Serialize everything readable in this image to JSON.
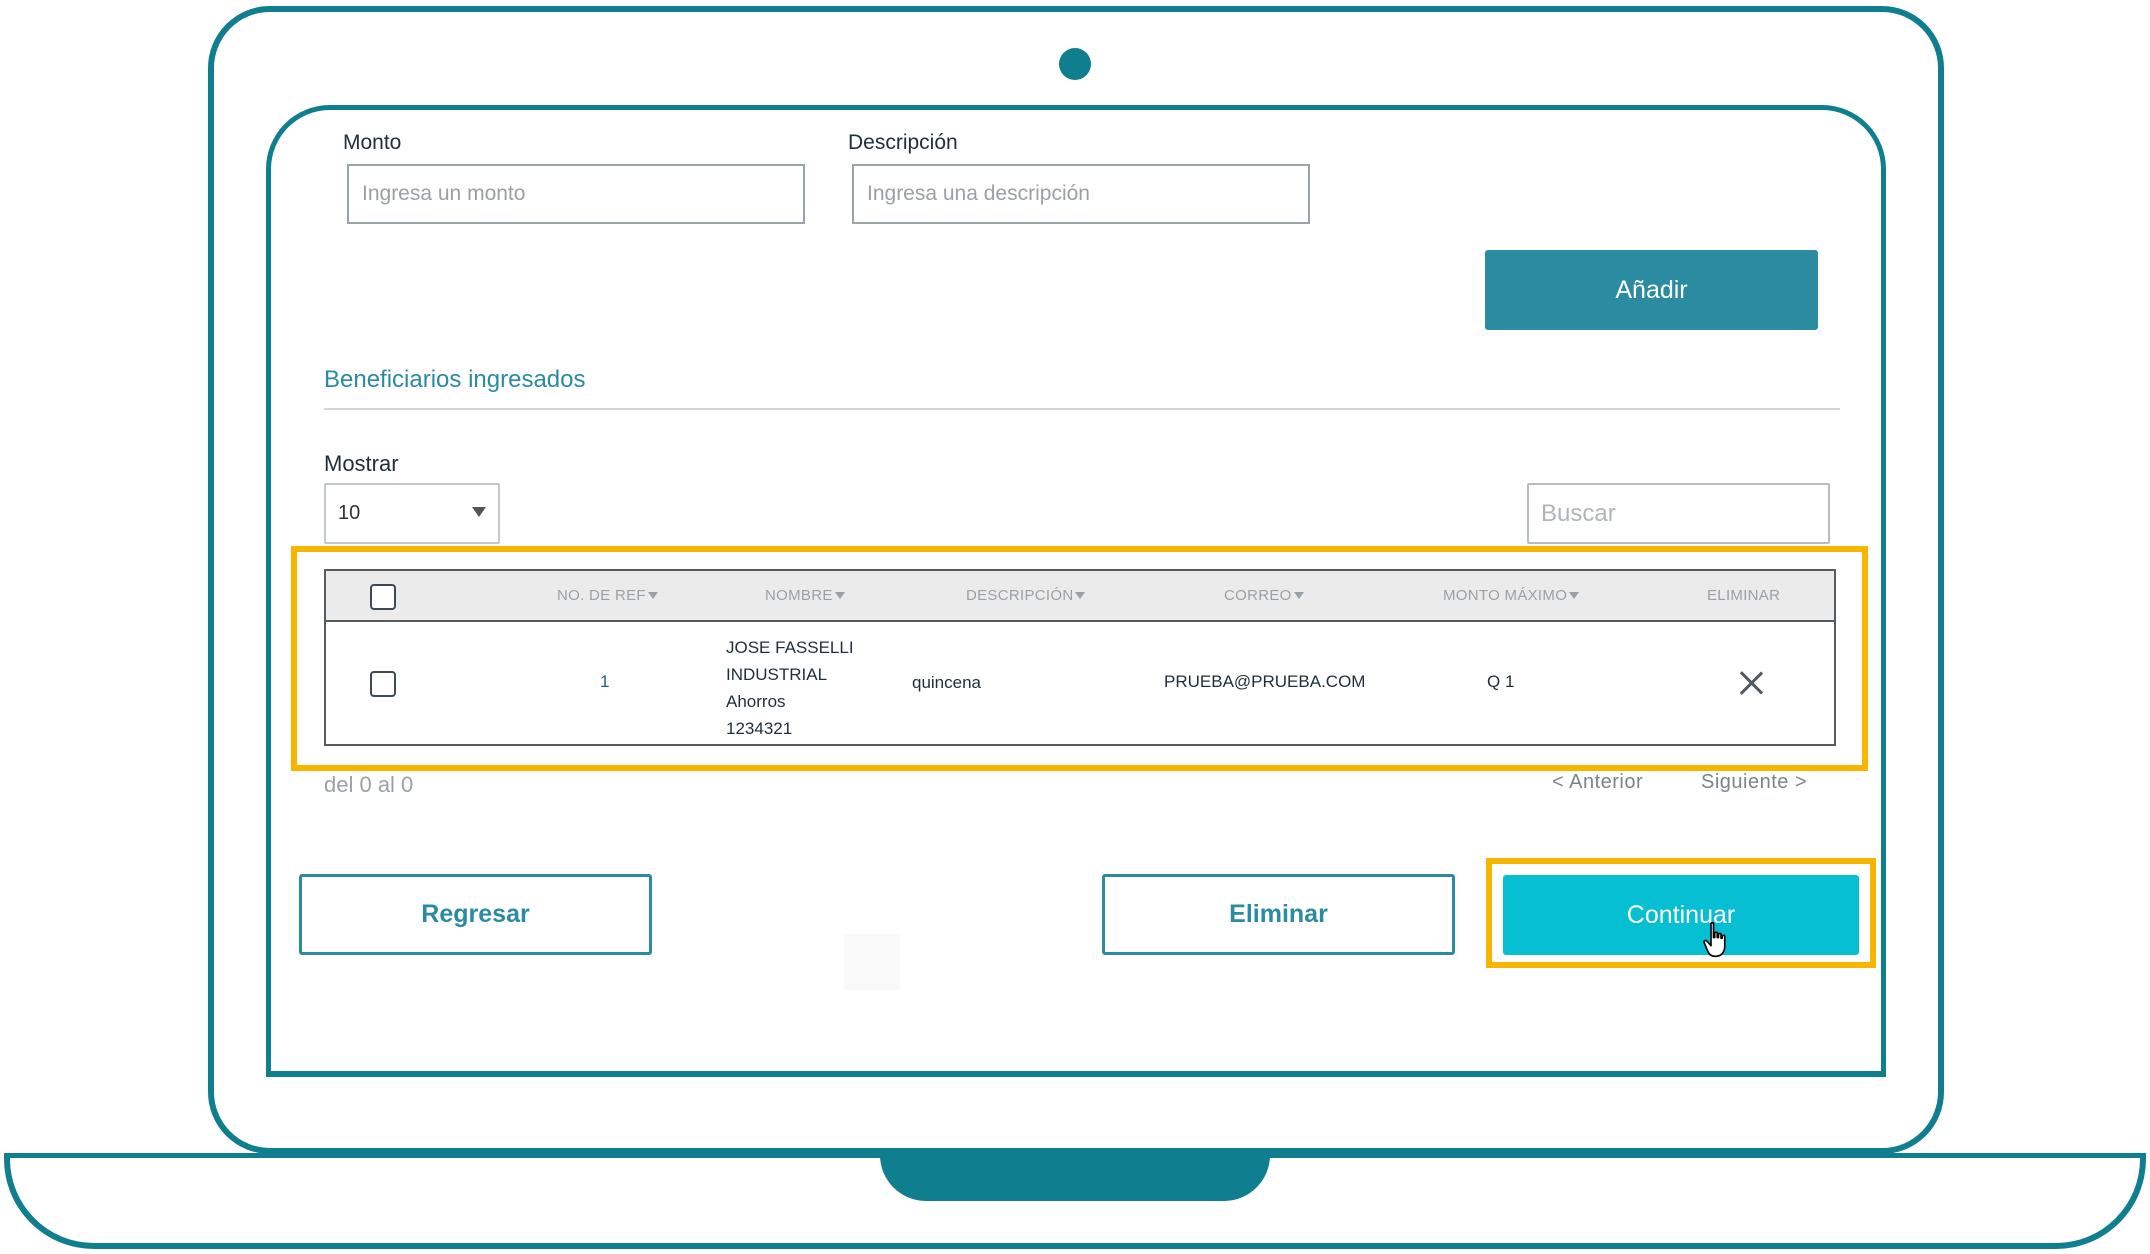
{
  "form": {
    "monto_label": "Monto",
    "monto_placeholder": "Ingresa un monto",
    "descripcion_label": "Descripción",
    "descripcion_placeholder": "Ingresa una descripción",
    "add_label": "Añadir"
  },
  "section": {
    "title": "Beneficiarios ingresados",
    "show_label": "Mostrar",
    "show_value": "10",
    "search_placeholder": "Buscar"
  },
  "table": {
    "headers": [
      "NO. DE REF",
      "NOMBRE",
      "DESCRIPCIÓN",
      "CORREO",
      "MONTO MÁXIMO",
      "ELIMINAR"
    ],
    "rows": [
      {
        "ref": "1",
        "name_lines": [
          "JOSE FASSELLI",
          "INDUSTRIAL",
          "Ahorros",
          "1234321"
        ],
        "descripcion": "quincena",
        "correo": "PRUEBA@PRUEBA.COM",
        "monto": "Q 1"
      }
    ]
  },
  "pager": {
    "info": "del 0 al 0",
    "prev": "< Anterior",
    "next": "Siguiente >"
  },
  "actions": {
    "back_label": "Regresar",
    "delete_label": "Eliminar",
    "continue_label": "Continuar"
  },
  "colors": {
    "frame": "#0f7f8f",
    "accent": "#2a8ba1",
    "primary": "#07bfd3",
    "highlight": "#f7b500"
  },
  "icons": [
    "close-icon",
    "hand-pointer-icon",
    "camera-dot",
    "dropdown-caret-icon",
    "sort-caret-icon"
  ]
}
